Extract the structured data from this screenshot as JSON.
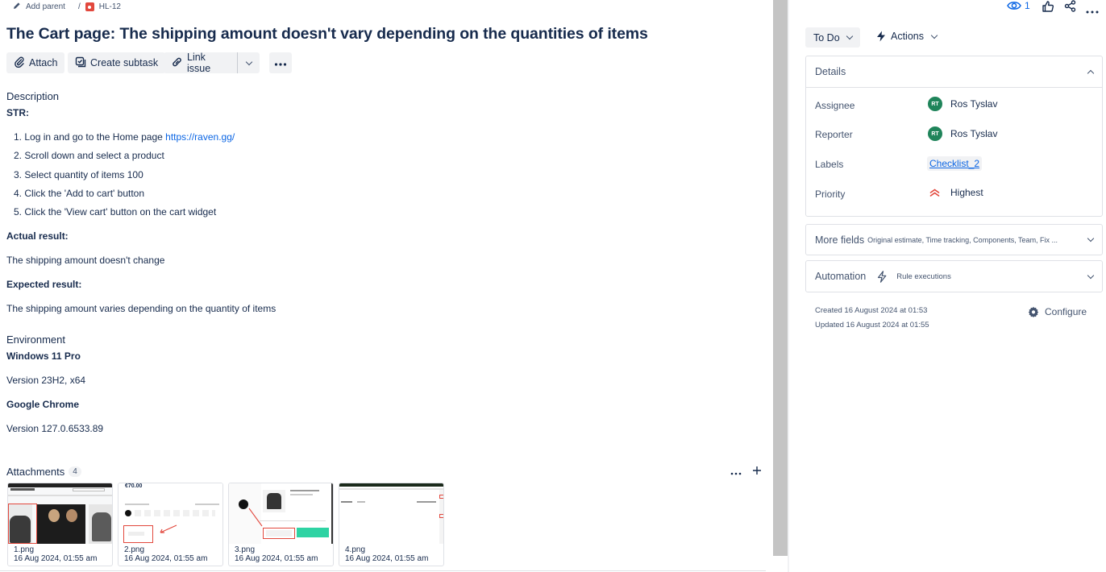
{
  "breadcrumb": {
    "add_parent": "Add parent",
    "separator": "/",
    "issue_key": "HL-12"
  },
  "issue": {
    "title": "The Cart page: The shipping amount doesn't vary depending on the quantities of items"
  },
  "toolbar": {
    "attach": "Attach",
    "create_subtask": "Create subtask",
    "link_issue": "Link issue"
  },
  "description": {
    "heading": "Description",
    "str_label": "STR:",
    "steps": [
      {
        "num": "1.",
        "text": "Log in and go to the Home page ",
        "link": "https://raven.gg/"
      },
      {
        "num": "2.",
        "text": "Scroll down and select a product"
      },
      {
        "num": "3.",
        "text": "Select quantity of items 100"
      },
      {
        "num": "4.",
        "text": "Click the 'Add to cart' button"
      },
      {
        "num": "5.",
        "text": "Click the 'View cart' button on the cart widget"
      }
    ],
    "actual_label": "Actual result:",
    "actual_text": "The shipping amount doesn't change",
    "expected_label": "Expected result:",
    "expected_text": "The shipping amount varies depending on the quantity of items"
  },
  "environment": {
    "heading": "Environment",
    "os": "Windows 11 Pro",
    "os_version": "Version 23H2, x64",
    "browser": "Google Chrome",
    "browser_version": "Version 127.0.6533.89"
  },
  "attachments": {
    "heading": "Attachments",
    "count": "4",
    "items": [
      {
        "name": "1.png",
        "date": "16 Aug 2024, 01:55 am"
      },
      {
        "name": "2.png",
        "date": "16 Aug 2024, 01:55 am"
      },
      {
        "name": "3.png",
        "date": "16 Aug 2024, 01:55 am"
      },
      {
        "name": "4.png",
        "date": "16 Aug 2024, 01:55 am"
      }
    ],
    "thumb2_price": "€70.00"
  },
  "header_actions": {
    "watchers": "1"
  },
  "status": {
    "value": "To Do",
    "actions": "Actions"
  },
  "details": {
    "heading": "Details",
    "assignee_label": "Assignee",
    "assignee_initials": "RT",
    "assignee": "Ros Tyslav",
    "reporter_label": "Reporter",
    "reporter_initials": "RT",
    "reporter": "Ros Tyslav",
    "labels_label": "Labels",
    "label_value": "Checklist_2",
    "priority_label": "Priority",
    "priority": "Highest",
    "priority_color": "#e2483d"
  },
  "more_fields": {
    "label": "More fields",
    "hint": "Original estimate, Time tracking, Components, Team, Fix ..."
  },
  "automation": {
    "label": "Automation",
    "hint": "Rule executions"
  },
  "meta": {
    "created": "Created 16 August 2024 at 01:53",
    "updated": "Updated 16 August 2024 at 01:55",
    "configure": "Configure"
  },
  "colors": {
    "accent": "#0c66e4",
    "avatar": "#1f845a",
    "text": "#172b4d"
  }
}
